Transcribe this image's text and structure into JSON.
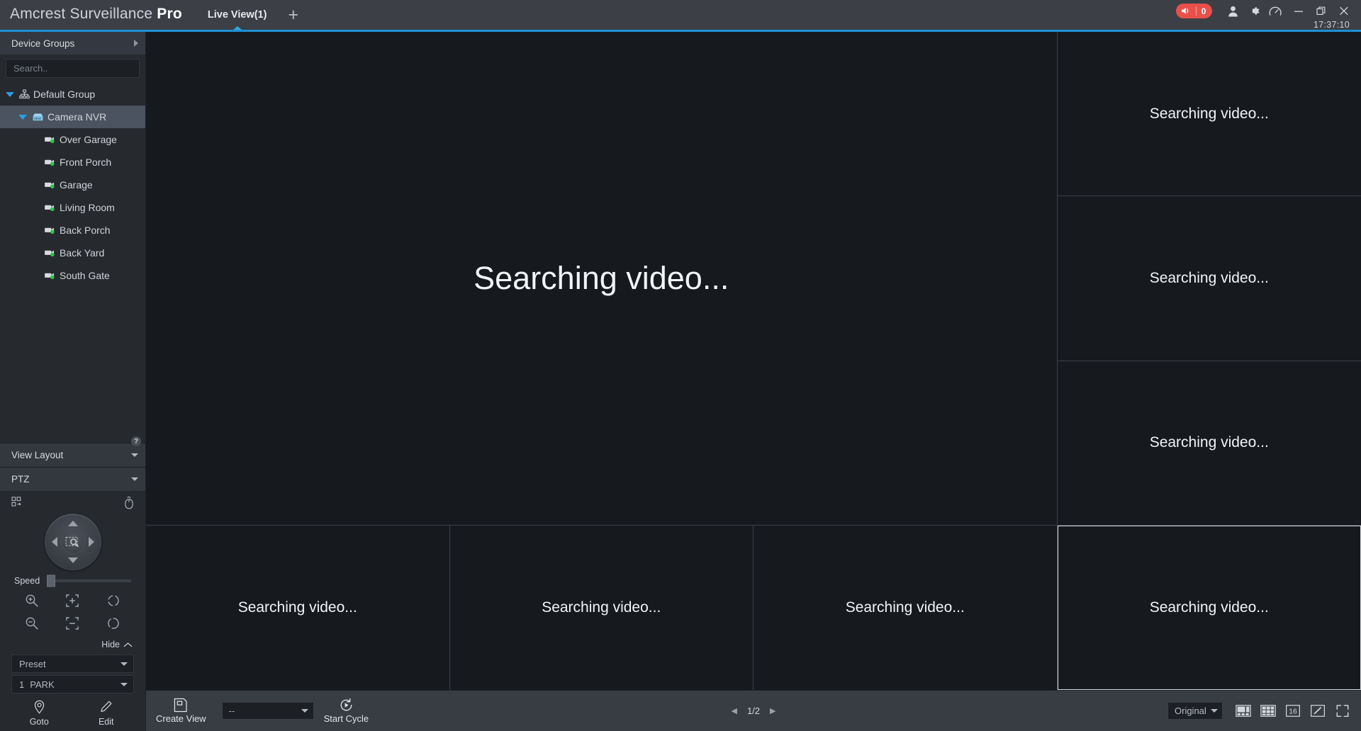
{
  "titlebar": {
    "brand_prefix": "Amcrest Surveillance ",
    "brand_bold": "Pro",
    "tab_label": "Live View(1)",
    "add_tab_label": "+",
    "alarm_count": "0",
    "alarm_icon": "speaker-mute-icon",
    "user_icon": "user-icon",
    "settings_icon": "gear-icon",
    "dashboard_icon": "gauge-icon",
    "minimize_icon": "minimize-icon",
    "restore_icon": "restore-icon",
    "close_icon": "close-icon",
    "clock": "17:37:10",
    "accent_color": "#1f8fd0",
    "alarm_color": "#e9504a"
  },
  "sidebar": {
    "device_groups_title": "Device Groups",
    "device_groups_expand_icon": "chevron-right-icon",
    "search": {
      "placeholder": "Search..",
      "value": "",
      "icon": "search-icon"
    },
    "tree": [
      {
        "label": "Default Group",
        "level": 0,
        "icon": "group-icon",
        "expanded": true,
        "selected": false
      },
      {
        "label": "Camera NVR",
        "level": 1,
        "icon": "nvr-icon",
        "expanded": true,
        "selected": true
      },
      {
        "label": "Over Garage",
        "level": 2,
        "icon": "camera-online-icon",
        "selected": false
      },
      {
        "label": "Front Porch",
        "level": 2,
        "icon": "camera-online-icon",
        "selected": false
      },
      {
        "label": "Garage",
        "level": 2,
        "icon": "camera-online-icon",
        "selected": false
      },
      {
        "label": "Living Room",
        "level": 2,
        "icon": "camera-online-icon",
        "selected": false
      },
      {
        "label": "Back Porch",
        "level": 2,
        "icon": "camera-online-icon",
        "selected": false
      },
      {
        "label": "Back Yard",
        "level": 2,
        "icon": "camera-online-icon",
        "selected": false
      },
      {
        "label": "South Gate",
        "level": 2,
        "icon": "camera-online-icon",
        "selected": false
      }
    ],
    "view_layout": {
      "title": "View Layout",
      "chevron": "chevron-down-icon",
      "help": "?"
    },
    "ptz": {
      "title": "PTZ",
      "chevron": "chevron-down-icon",
      "menu_icon": "ptz-menu-icon",
      "mouse_icon": "mouse-control-icon",
      "joystick": {
        "up": "arrow-up-icon",
        "down": "arrow-down-icon",
        "left": "arrow-left-icon",
        "right": "arrow-right-icon",
        "center": "zoom-area-icon"
      },
      "speed_label": "Speed",
      "speed_value": 0,
      "buttons": [
        "zoom-in-icon",
        "focus-near-icon",
        "iris-open-icon",
        "zoom-out-icon",
        "focus-far-icon",
        "iris-close-icon"
      ],
      "hide_label": "Hide",
      "hide_icon": "chevron-up-icon",
      "mode_select": {
        "value": "Preset",
        "caret": "chevron-down-icon"
      },
      "preset_select": {
        "number": "1",
        "value": "PARK",
        "caret": "chevron-down-icon"
      },
      "goto": {
        "label": "Goto",
        "icon": "location-pin-icon"
      },
      "edit": {
        "label": "Edit",
        "icon": "pencil-icon"
      }
    }
  },
  "main": {
    "cells": [
      {
        "text": "Searching video...",
        "big": true,
        "selected": false
      },
      {
        "text": "Searching video...",
        "big": false,
        "selected": false
      },
      {
        "text": "Searching video...",
        "big": false,
        "selected": false
      },
      {
        "text": "Searching video...",
        "big": false,
        "selected": false
      },
      {
        "text": "Searching video...",
        "big": false,
        "selected": false
      },
      {
        "text": "Searching video...",
        "big": false,
        "selected": false
      },
      {
        "text": "Searching video...",
        "big": false,
        "selected": false
      },
      {
        "text": "Searching video...",
        "big": false,
        "selected": true
      }
    ]
  },
  "bottombar": {
    "create_view": {
      "label": "Create View",
      "icon": "save-view-icon"
    },
    "view_select": {
      "value": "--",
      "caret": "chevron-down-icon"
    },
    "start_cycle": {
      "label": "Start Cycle",
      "icon": "cycle-icon"
    },
    "pager": {
      "prev_icon": "caret-left-icon",
      "text": "1/2",
      "next_icon": "caret-right-icon"
    },
    "scale_select": {
      "value": "Original",
      "caret": "chevron-down-icon"
    },
    "layout_buttons": [
      {
        "name": "layout-1plus5-icon",
        "label": ""
      },
      {
        "name": "layout-grid-icon",
        "label": ""
      },
      {
        "name": "layout-16-icon",
        "label": "16"
      },
      {
        "name": "layout-custom-icon",
        "label": ""
      },
      {
        "name": "fullscreen-icon",
        "label": ""
      }
    ]
  }
}
